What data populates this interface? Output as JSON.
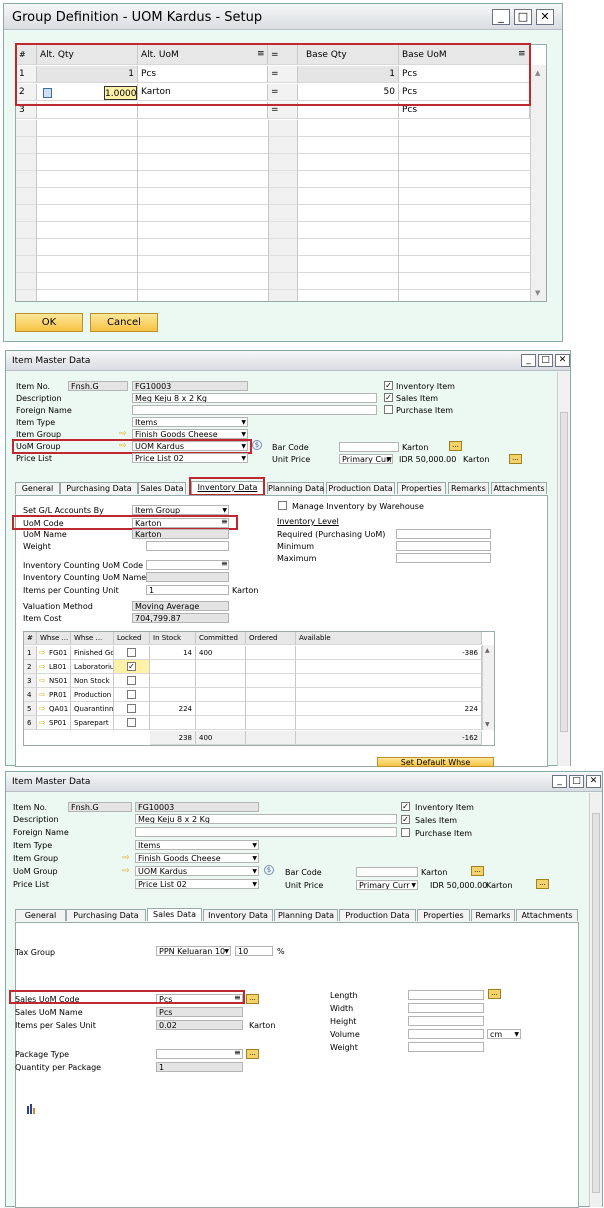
{
  "win1": {
    "title": "Group Definition - UOM Kardus - Setup",
    "columns": [
      "#",
      "Alt. Qty",
      "Alt. UoM",
      "=",
      "Base Qty",
      "Base UoM"
    ],
    "rows": [
      {
        "num": "1",
        "alt_qty": "1",
        "alt_uom": "Pcs",
        "eq": "=",
        "base_qty": "1",
        "base_uom": "Pcs"
      },
      {
        "num": "2",
        "alt_qty": "1.0000",
        "alt_uom": "Karton",
        "eq": "=",
        "base_qty": "50",
        "base_uom": "Pcs"
      },
      {
        "num": "3",
        "alt_qty": "",
        "alt_uom": "",
        "eq": "=",
        "base_qty": "",
        "base_uom": "Pcs"
      }
    ],
    "ok": "OK",
    "cancel": "Cancel"
  },
  "win2": {
    "title": "Item Master Data",
    "item_no_label": "Item No.",
    "item_no_series": "Fnsh.G",
    "item_no": "FG10003",
    "description_label": "Description",
    "description": "Meg Keju 8 x 2 Kg",
    "foreign_label": "Foreign Name",
    "item_type_label": "Item Type",
    "item_type": "Items",
    "item_group_label": "Item Group",
    "item_group": "Finish Goods Cheese",
    "uom_group_label": "UoM Group",
    "uom_group": "UOM Kardus",
    "price_list_label": "Price List",
    "price_list": "Price List 02",
    "inventory_item": "Inventory Item",
    "sales_item": "Sales Item",
    "purchase_item": "Purchase Item",
    "bar_code_label": "Bar Code",
    "bar_code_unit": "Karton",
    "unit_price_label": "Unit Price",
    "unit_price_cur": "Primary Curr",
    "unit_price_val": "IDR 50,000.00",
    "unit_price_unit": "Karton",
    "tabs": [
      "General",
      "Purchasing Data",
      "Sales Data",
      "Inventory Data",
      "Planning Data",
      "Production Data",
      "Properties",
      "Remarks",
      "Attachments"
    ],
    "set_gl_label": "Set G/L Accounts By",
    "set_gl": "Item Group",
    "uom_code_label": "UoM Code",
    "uom_code": "Karton",
    "uom_name_label": "UoM Name",
    "uom_name": "Karton",
    "weight_label": "Weight",
    "inv_count_code_label": "Inventory Counting UoM Code",
    "inv_count_name_label": "Inventory Counting UoM Name",
    "items_per_count_label": "Items per Counting Unit",
    "items_per_count": "1",
    "items_per_count_unit": "Karton",
    "valuation_label": "Valuation Method",
    "valuation": "Moving Average",
    "item_cost_label": "Item Cost",
    "item_cost": "704,799.87",
    "manage_by_whse": "Manage Inventory by Warehouse",
    "inventory_level": "Inventory Level",
    "required_label": "Required (Purchasing UoM)",
    "minimum_label": "Minimum",
    "maximum_label": "Maximum",
    "whse_columns": [
      "#",
      "Whse ...",
      "Whse ...",
      "Locked",
      "In Stock",
      "Committed",
      "Ordered",
      "Available"
    ],
    "whse_rows": [
      {
        "num": "1",
        "code": "FG01",
        "name": "Finished Goo",
        "locked": false,
        "in_stock": "14",
        "committed": "400",
        "ordered": "",
        "available": "-386"
      },
      {
        "num": "2",
        "code": "LB01",
        "name": "Laboratorium",
        "locked": true,
        "in_stock": "",
        "committed": "",
        "ordered": "",
        "available": ""
      },
      {
        "num": "3",
        "code": "NS01",
        "name": "Non Stock",
        "locked": false,
        "in_stock": "",
        "committed": "",
        "ordered": "",
        "available": ""
      },
      {
        "num": "4",
        "code": "PR01",
        "name": "Production",
        "locked": false,
        "in_stock": "",
        "committed": "",
        "ordered": "",
        "available": ""
      },
      {
        "num": "5",
        "code": "QA01",
        "name": "Quarantinne",
        "locked": false,
        "in_stock": "224",
        "committed": "",
        "ordered": "",
        "available": "224"
      },
      {
        "num": "6",
        "code": "SP01",
        "name": "Sparepart",
        "locked": false,
        "in_stock": "",
        "committed": "",
        "ordered": "",
        "available": ""
      }
    ],
    "totals": {
      "in_stock": "238",
      "committed": "400",
      "available": "-162"
    },
    "set_default_whse": "Set Default Whse"
  },
  "win3": {
    "title": "Item Master Data",
    "tax_group_label": "Tax Group",
    "tax_group": "PPN Keluaran 10",
    "tax_rate": "10",
    "tax_pct": "%",
    "sales_uom_code_label": "Sales UoM Code",
    "sales_uom_code": "Pcs",
    "sales_uom_name_label": "Sales UoM Name",
    "sales_uom_name": "Pcs",
    "items_per_sales_label": "Items per Sales Unit",
    "items_per_sales": "0.02",
    "items_per_sales_unit": "Karton",
    "package_type_label": "Package Type",
    "qty_per_package_label": "Quantity per Package",
    "qty_per_package": "1",
    "length_label": "Length",
    "width_label": "Width",
    "height_label": "Height",
    "volume_label": "Volume",
    "volume_unit": "cm",
    "weight_label": "Weight"
  },
  "colors": {
    "highlight": "#c0282f",
    "button": "#f6c343",
    "window_bg": "#ecf8f2"
  }
}
